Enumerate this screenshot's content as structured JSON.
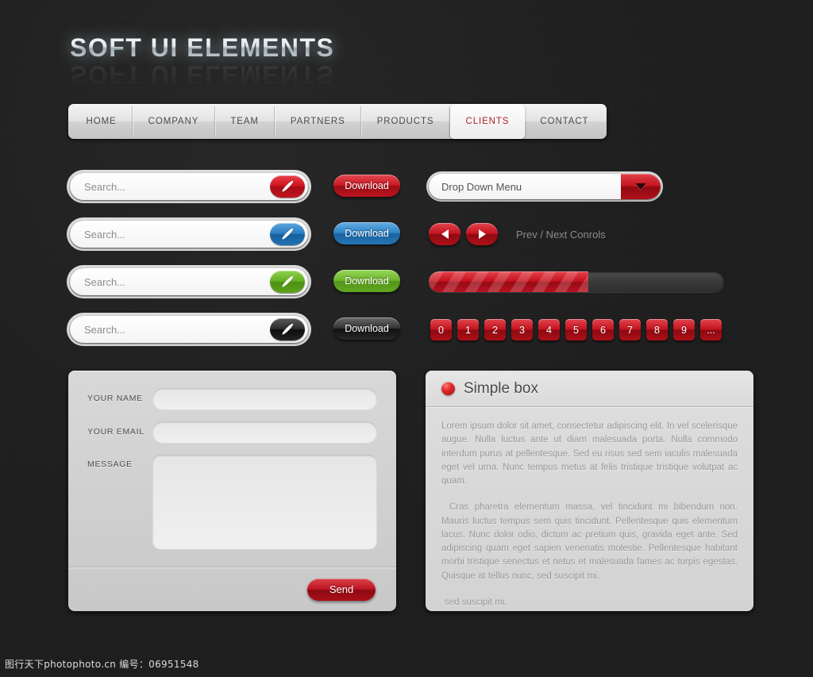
{
  "page": {
    "title": "SOFT UI ELEMENTS",
    "background_color": "#1c1c1c",
    "accent_color": "#c4121e"
  },
  "nav": {
    "items": [
      {
        "label": "HOME",
        "active": false
      },
      {
        "label": "COMPANY",
        "active": false
      },
      {
        "label": "TEAM",
        "active": false
      },
      {
        "label": "PARTNERS",
        "active": false
      },
      {
        "label": "PRODUCTS",
        "active": false
      },
      {
        "label": "CLIENTS",
        "active": true
      },
      {
        "label": "CONTACT",
        "active": false
      }
    ],
    "active_color": "#b32027"
  },
  "search_bars": [
    {
      "placeholder": "Search...",
      "value": "",
      "button_color": "red",
      "icon": "search-icon"
    },
    {
      "placeholder": "Search...",
      "value": "",
      "button_color": "blue",
      "icon": "search-icon"
    },
    {
      "placeholder": "Search...",
      "value": "",
      "button_color": "green",
      "icon": "search-icon"
    },
    {
      "placeholder": "Search...",
      "value": "",
      "button_color": "black",
      "icon": "search-icon"
    }
  ],
  "download_buttons": [
    {
      "label": "Download",
      "color": "red"
    },
    {
      "label": "Download",
      "color": "blue"
    },
    {
      "label": "Download",
      "color": "green"
    },
    {
      "label": "Download",
      "color": "black"
    }
  ],
  "dropdown": {
    "label": "Drop Down Menu",
    "arrow_icon": "chevron-down-icon"
  },
  "prev_next": {
    "prev_icon": "triangle-left-icon",
    "next_icon": "triangle-right-icon",
    "label": "Prev / Next Conrols"
  },
  "progress": {
    "percent": 54
  },
  "pagination": {
    "items": [
      "0",
      "1",
      "2",
      "3",
      "4",
      "5",
      "6",
      "7",
      "8",
      "9",
      "..."
    ]
  },
  "contact_form": {
    "name_label": "YOUR NAME",
    "name_value": "",
    "email_label": "YOUR EMAIL",
    "email_value": "",
    "message_label": "MESSAGE",
    "message_value": "",
    "send_label": "Send"
  },
  "simple_box": {
    "icon": "red-circle-icon",
    "title": "Simple box",
    "paragraph1": "Lorem ipsum dolor sit amet, consectetur adipiscing elit. In vel scelerisque augue. Nulla luctus ante ut diam malesuada porta. Nulla commodo interdum purus at pellentesque. Sed eu risus sed sem iaculis malesuada eget vel urna. Nunc tempus metus at felis tristique tristique volutpat ac quam.",
    "paragraph2": "Cras pharetra elementum massa, vel tincidunt mi bibendum non. Mauris luctus tempus sem quis tincidunt. Pellentesque quis elementum lacus. Nunc dolor odio, dictum ac pretium quis, gravida eget ante. Sed adipiscing quam eget sapien venenatis molestie. Pellentesque habitant morbi tristique senectus et netus et malesuada fames ac turpis egestas. Quisque at tellus nunc, sed suscipit mi.",
    "paragraph3": "sed suscipit mi."
  },
  "footer": {
    "watermark": "图行天下photophoto.cn  编号：06951548"
  }
}
